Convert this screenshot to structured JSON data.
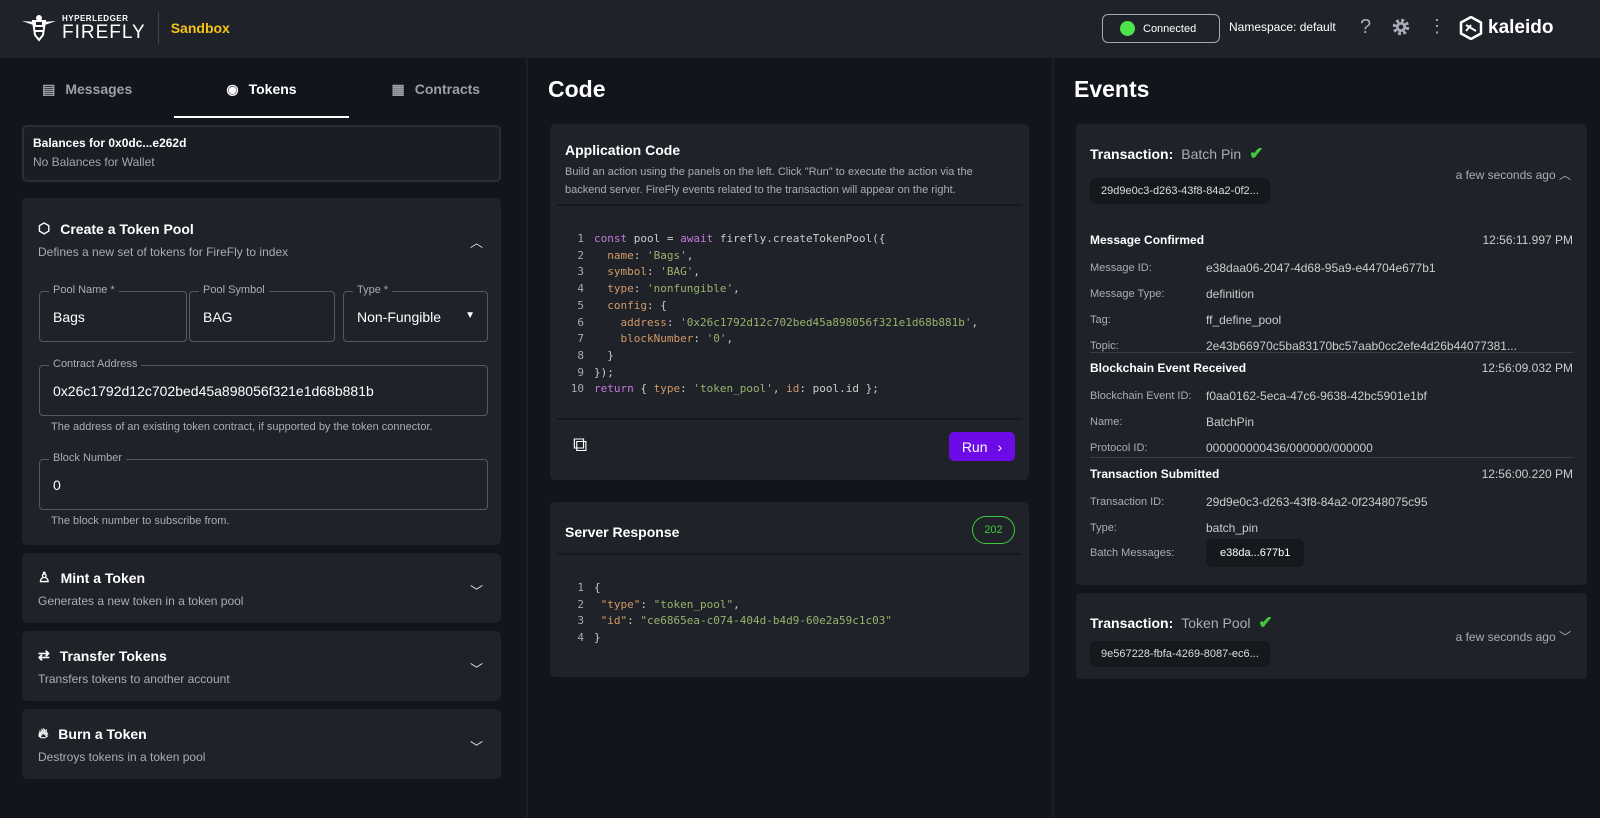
{
  "header": {
    "logo_small": "HYPERLEDGER",
    "logo_big": "FIREFLY",
    "app": "Sandbox",
    "status": "Connected",
    "namespace": "Namespace: default",
    "brand": "kaleido",
    "status_color": "#4de34d",
    "accent": "#6d0be8"
  },
  "tabs": [
    {
      "label": "Messages"
    },
    {
      "label": "Tokens"
    },
    {
      "label": "Contracts"
    }
  ],
  "balances": {
    "title": "Balances for 0x0dc...e262d",
    "empty": "No Balances for Wallet"
  },
  "create_pool": {
    "title": "Create a Token Pool",
    "desc": "Defines a new set of tokens for FireFly to index",
    "pool_name": {
      "label": "Pool Name *",
      "value": "Bags"
    },
    "pool_symbol": {
      "label": "Pool Symbol",
      "value": "BAG"
    },
    "type": {
      "label": "Type *",
      "value": "Non-Fungible"
    },
    "contract": {
      "label": "Contract Address",
      "value": "0x26c1792d12c702bed45a898056f321e1d68b881b",
      "help": "The address of an existing token contract, if supported by the token connector."
    },
    "block": {
      "label": "Block Number",
      "value": "0",
      "help": "The block number to subscribe from."
    }
  },
  "sections": [
    {
      "title": "Mint a Token",
      "desc": "Generates a new token in a token pool"
    },
    {
      "title": "Transfer Tokens",
      "desc": "Transfers tokens to another account"
    },
    {
      "title": "Burn a Token",
      "desc": "Destroys tokens in a token pool"
    }
  ],
  "code": {
    "heading": "Code",
    "title": "Application Code",
    "desc": "Build an action using the panels on the left. Click \"Run\" to execute the action via the backend server. FireFly events related to the transaction will appear on the right.",
    "run": "Run",
    "lines": [
      [
        [
          "kw",
          "const"
        ],
        [
          "pl",
          " pool = "
        ],
        [
          "kw",
          "await"
        ],
        [
          "pl",
          " firefly.createTokenPool({"
        ]
      ],
      [
        [
          "pl",
          "  "
        ],
        [
          "pr",
          "name"
        ],
        [
          "pl",
          ": "
        ],
        [
          "st",
          "'Bags'"
        ],
        [
          "pl",
          ","
        ]
      ],
      [
        [
          "pl",
          "  "
        ],
        [
          "pr",
          "symbol"
        ],
        [
          "pl",
          ": "
        ],
        [
          "st",
          "'BAG'"
        ],
        [
          "pl",
          ","
        ]
      ],
      [
        [
          "pl",
          "  "
        ],
        [
          "pr",
          "type"
        ],
        [
          "pl",
          ": "
        ],
        [
          "st",
          "'nonfungible'"
        ],
        [
          "pl",
          ","
        ]
      ],
      [
        [
          "pl",
          "  "
        ],
        [
          "pr",
          "config"
        ],
        [
          "pl",
          ": {"
        ]
      ],
      [
        [
          "pl",
          "    "
        ],
        [
          "pr",
          "address"
        ],
        [
          "pl",
          ": "
        ],
        [
          "st",
          "'0x26c1792d12c702bed45a898056f321e1d68b881b'"
        ],
        [
          "pl",
          ","
        ]
      ],
      [
        [
          "pl",
          "    "
        ],
        [
          "pr",
          "blockNumber"
        ],
        [
          "pl",
          ": "
        ],
        [
          "st",
          "'0'"
        ],
        [
          "pl",
          ","
        ]
      ],
      [
        [
          "pl",
          "  }"
        ]
      ],
      [
        [
          "pl",
          "});"
        ]
      ],
      [
        [
          "kw",
          "return"
        ],
        [
          "pl",
          " { "
        ],
        [
          "pr",
          "type"
        ],
        [
          "pl",
          ": "
        ],
        [
          "st",
          "'token_pool'"
        ],
        [
          "pl",
          ", "
        ],
        [
          "pr",
          "id"
        ],
        [
          "pl",
          ": pool.id };"
        ]
      ]
    ]
  },
  "response": {
    "title": "Server Response",
    "status": "202",
    "lines": [
      [
        [
          "pl",
          "{"
        ]
      ],
      [
        [
          "pl",
          " "
        ],
        [
          "pr",
          "\"type\""
        ],
        [
          "pl",
          ": "
        ],
        [
          "st",
          "\"token_pool\""
        ],
        [
          "pl",
          ","
        ]
      ],
      [
        [
          "pl",
          " "
        ],
        [
          "pr",
          "\"id\""
        ],
        [
          "pl",
          ": "
        ],
        [
          "st",
          "\"ce6865ea-c074-404d-b4d9-60e2a59c1c03\""
        ]
      ],
      [
        [
          "pl",
          "}"
        ]
      ]
    ]
  },
  "events": {
    "heading": "Events",
    "tx1": {
      "label": "Transaction:",
      "type": "Batch Pin",
      "chip": "29d9e0c3-d263-43f8-84a2-0f2...",
      "ago": "a few seconds ago",
      "sections": [
        {
          "title": "Message Confirmed",
          "time": "12:56:11.997 PM",
          "rows": [
            [
              "Message ID:",
              "e38daa06-2047-4d68-95a9-e44704e677b1"
            ],
            [
              "Message Type:",
              "definition"
            ],
            [
              "Tag:",
              "ff_define_pool"
            ],
            [
              "Topic:",
              "2e43b66970c5ba83170bc57aab0cc2efe4d26b44077381..."
            ]
          ]
        },
        {
          "title": "Blockchain Event Received",
          "time": "12:56:09.032 PM",
          "rows": [
            [
              "Blockchain Event ID:",
              "f0aa0162-5eca-47c6-9638-42bc5901e1bf"
            ],
            [
              "Name:",
              "BatchPin"
            ],
            [
              "Protocol ID:",
              "000000000436/000000/000000"
            ]
          ]
        },
        {
          "title": "Transaction Submitted",
          "time": "12:56:00.220 PM",
          "rows": [
            [
              "Transaction ID:",
              "29d9e0c3-d263-43f8-84a2-0f2348075c95"
            ],
            [
              "Type:",
              "batch_pin"
            ]
          ]
        }
      ],
      "batch_label": "Batch Messages:",
      "batch_chip": "e38da...677b1"
    },
    "tx2": {
      "label": "Transaction:",
      "type": "Token Pool",
      "chip": "9e567228-fbfa-4269-8087-ec6...",
      "ago": "a few seconds ago"
    }
  }
}
